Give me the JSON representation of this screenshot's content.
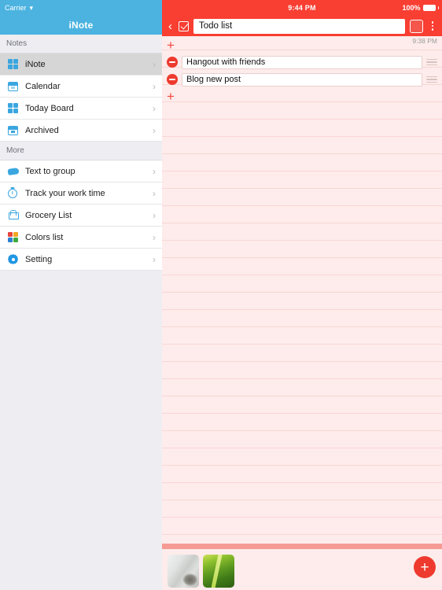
{
  "sidebar": {
    "status": {
      "carrier": "Carrier",
      "wifi_icon": "wifi-icon"
    },
    "app_title": "iNote",
    "sections": [
      {
        "header": "Notes",
        "items": [
          {
            "label": "iNote",
            "icon": "grid-icon",
            "active": true
          },
          {
            "label": "Calendar",
            "icon": "calendar-icon",
            "active": false
          },
          {
            "label": "Today Board",
            "icon": "grid-icon",
            "active": false
          },
          {
            "label": "Archived",
            "icon": "archive-box-icon",
            "active": false
          }
        ]
      },
      {
        "header": "More",
        "items": [
          {
            "label": "Text to group",
            "icon": "tag-icon",
            "active": false
          },
          {
            "label": "Track your work time",
            "icon": "stopwatch-icon",
            "active": false
          },
          {
            "label": "Grocery List",
            "icon": "shopping-cart-icon",
            "active": false
          },
          {
            "label": "Colors list",
            "icon": "color-grid-icon",
            "active": false
          },
          {
            "label": "Setting",
            "icon": "gear-icon",
            "active": false
          }
        ]
      }
    ],
    "chevron": "›",
    "accent_color": "#3aa6e0",
    "header_color": "#4cb3e0"
  },
  "main": {
    "status": {
      "time": "9:44 PM",
      "battery_percent": "100%"
    },
    "nav": {
      "back_icon": "chevron-left-icon",
      "back_glyph": "‹",
      "checkbox_icon": "checkbox-checked-icon",
      "note_title": "Todo list",
      "note_title_placeholder": "Title",
      "color_swatch": "#f3564b",
      "overflow_icon": "more-vertical-icon"
    },
    "note_time": "9:38 PM",
    "add_glyph": "+",
    "todos": [
      {
        "text": "Hangout with friends",
        "remove_icon": "minus-circle-icon",
        "drag_icon": "drag-handle-icon"
      },
      {
        "text": "Blog new post",
        "remove_icon": "minus-circle-icon",
        "drag_icon": "drag-handle-icon"
      }
    ],
    "attachments": [
      {
        "name": "photo-thumbnail-1"
      },
      {
        "name": "photo-thumbnail-2"
      }
    ],
    "fab_glyph": "+",
    "accent_color": "#f93e32",
    "paper_color": "#fdeceb",
    "rule_color": "#f9d6d4"
  }
}
